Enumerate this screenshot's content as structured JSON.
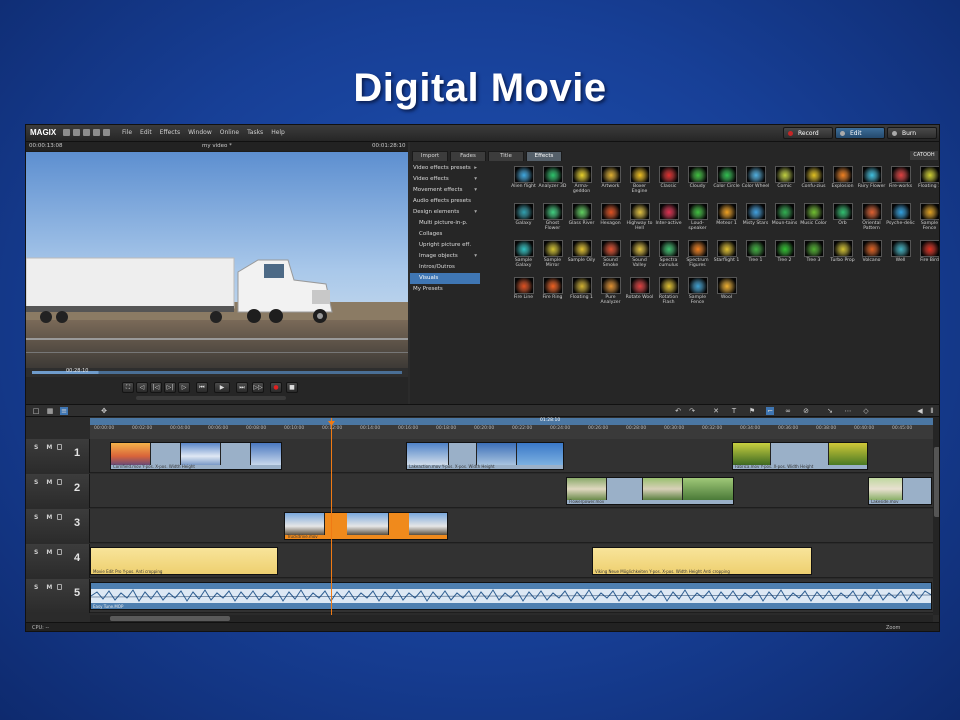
{
  "slide": {
    "title": "Digital Movie"
  },
  "app": {
    "logo": "MAGIX",
    "menu": [
      "File",
      "Edit",
      "Effects",
      "Window",
      "Online",
      "Tasks",
      "Help"
    ],
    "modes": [
      {
        "label": "Record",
        "active": false
      },
      {
        "label": "Edit",
        "active": true
      },
      {
        "label": "Burn",
        "active": false
      }
    ]
  },
  "preview": {
    "time_left": "00:00:13:08",
    "title": "my video *",
    "time_right": "00:01:28:10",
    "scrub_time": "00:28:10",
    "scrub_position": 0.18,
    "transport_buttons": [
      "⛶",
      "◁",
      "|◁",
      "▷|",
      "▷",
      "⏮",
      "▶",
      "⏭",
      "▷▷",
      "●",
      "■"
    ]
  },
  "panel": {
    "tabs": [
      {
        "label": "Import",
        "active": false
      },
      {
        "label": "Fades",
        "active": false
      },
      {
        "label": "Title",
        "active": false
      },
      {
        "label": "Effects",
        "active": true
      }
    ],
    "brand": "CATOOH",
    "categories": [
      {
        "label": "Video effects presets",
        "sub": false,
        "arrow": "▸",
        "selected": false
      },
      {
        "label": "Video effects",
        "sub": false,
        "arrow": "▾",
        "selected": false
      },
      {
        "label": "Movement effects",
        "sub": false,
        "arrow": "▾",
        "selected": false
      },
      {
        "label": "Audio effects presets",
        "sub": false,
        "arrow": "",
        "selected": false
      },
      {
        "label": "Design elements",
        "sub": false,
        "arrow": "▾",
        "selected": false
      },
      {
        "label": "Multi picture-in-p.",
        "sub": true,
        "arrow": "",
        "selected": false
      },
      {
        "label": "Collages",
        "sub": true,
        "arrow": "",
        "selected": false
      },
      {
        "label": "Upright picture eff.",
        "sub": true,
        "arrow": "",
        "selected": false
      },
      {
        "label": "Image objects",
        "sub": true,
        "arrow": "▾",
        "selected": false
      },
      {
        "label": "Intros/Outros",
        "sub": true,
        "arrow": "",
        "selected": false
      },
      {
        "label": "Visuals",
        "sub": true,
        "arrow": "",
        "selected": true
      },
      {
        "label": "My Presets",
        "sub": false,
        "arrow": "",
        "selected": false
      }
    ],
    "effects": [
      {
        "label": "Alien flight",
        "color": "#3fa8e0"
      },
      {
        "label": "Analyzer 3D",
        "color": "#2cc36b"
      },
      {
        "label": "Arma-geddon",
        "color": "#e8d12a"
      },
      {
        "label": "Artwork",
        "color": "#e0b030"
      },
      {
        "label": "Boxer Engine",
        "color": "#f0c020"
      },
      {
        "label": "Classic",
        "color": "#e03030"
      },
      {
        "label": "Cloudy",
        "color": "#40c040"
      },
      {
        "label": "Color Circle",
        "color": "#30c050"
      },
      {
        "label": "Color Wheel",
        "color": "#50b0e0"
      },
      {
        "label": "Comic",
        "color": "#c0d040"
      },
      {
        "label": "Confu-zius",
        "color": "#e0c020"
      },
      {
        "label": "Explosion",
        "color": "#f08020"
      },
      {
        "label": "Fairy Flower",
        "color": "#40c0e0"
      },
      {
        "label": "Fire-works",
        "color": "#e04040"
      },
      {
        "label": "Floating 1",
        "color": "#d0d030"
      },
      {
        "label": "Galaxy",
        "color": "#30a0b0"
      },
      {
        "label": "Ghost Flower",
        "color": "#40d080"
      },
      {
        "label": "Glass River",
        "color": "#60d060"
      },
      {
        "label": "Hexagon",
        "color": "#e05020"
      },
      {
        "label": "Highway to Hell",
        "color": "#e0c040"
      },
      {
        "label": "Inter-active",
        "color": "#e03050"
      },
      {
        "label": "Loud-speaker",
        "color": "#40c040"
      },
      {
        "label": "Meteor 1",
        "color": "#f0a020"
      },
      {
        "label": "Misty Stars",
        "color": "#40a0e0"
      },
      {
        "label": "Moun-tains",
        "color": "#30b050"
      },
      {
        "label": "Music Color",
        "color": "#70c030"
      },
      {
        "label": "Orb",
        "color": "#30c070"
      },
      {
        "label": "Oriental Pattern",
        "color": "#e06030"
      },
      {
        "label": "Psyche-delic",
        "color": "#30a0e0"
      },
      {
        "label": "Sample Fence",
        "color": "#e0a020"
      },
      {
        "label": "Sample Galaxy",
        "color": "#30c0c0"
      },
      {
        "label": "Sample Mirror",
        "color": "#d0c030"
      },
      {
        "label": "Sample Oily",
        "color": "#e0c030"
      },
      {
        "label": "Sound Smoke",
        "color": "#e05030"
      },
      {
        "label": "Sound Valley",
        "color": "#e0c040"
      },
      {
        "label": "Spectra cumulus",
        "color": "#40c070"
      },
      {
        "label": "Spectrum Figures",
        "color": "#f08020"
      },
      {
        "label": "Starflight 1",
        "color": "#e0c030"
      },
      {
        "label": "Tree 1",
        "color": "#40b040"
      },
      {
        "label": "Tree 2",
        "color": "#30c030"
      },
      {
        "label": "Tree 3",
        "color": "#50b030"
      },
      {
        "label": "Turbo Prop",
        "color": "#d0c030"
      },
      {
        "label": "Volcano",
        "color": "#e06020"
      },
      {
        "label": "Well",
        "color": "#40b0c0"
      },
      {
        "label": "Fire Bird",
        "color": "#e03020"
      },
      {
        "label": "Fire Line",
        "color": "#e05020"
      },
      {
        "label": "Fire Ring",
        "color": "#f06020"
      },
      {
        "label": "Floating 1",
        "color": "#d0b030"
      },
      {
        "label": "Pure Analyzer",
        "color": "#e09030"
      },
      {
        "label": "Rotate Wool",
        "color": "#e04040"
      },
      {
        "label": "Rotation Flash",
        "color": "#e0c030"
      },
      {
        "label": "Sample Fence",
        "color": "#40a0d0"
      },
      {
        "label": "Wool",
        "color": "#f0b030"
      }
    ]
  },
  "timeline": {
    "ruler_band_label": "01:28:10",
    "ticks": [
      "00:00:00",
      "00:02:00",
      "00:04:00",
      "00:06:00",
      "00:08:00",
      "00:10:00",
      "00:12:00",
      "00:14:00",
      "00:16:00",
      "00:18:00",
      "00:20:00",
      "00:22:00",
      "00:24:00",
      "00:26:00",
      "00:28:00",
      "00:30:00",
      "00:32:00",
      "00:34:00",
      "00:36:00",
      "00:38:00",
      "00:40:00",
      "00:45:00"
    ],
    "tracks": [
      {
        "number": "1",
        "sm": "S M",
        "clips": [
          {
            "caption": "Cornfield.mov   Y-pos.  X-pos.  Width  Height"
          },
          {
            "caption": "Lakeaction.mov   Y-pos.  X-pos.  Width  Height"
          },
          {
            "caption": "Fabrica.mov   Y-pos.  X-pos.  Width  Height"
          }
        ]
      },
      {
        "number": "2",
        "sm": "S M",
        "clips": [
          {
            "caption": "Flowerpower.mov"
          },
          {
            "caption": "Lakeside.mov"
          }
        ]
      },
      {
        "number": "3",
        "sm": "S M",
        "clips": [
          {
            "caption": "Truckdrive.mov"
          }
        ]
      },
      {
        "number": "4",
        "sm": "S M",
        "clips": [
          {
            "caption": "Movie Edit Pro   Y-pos.  Anti cropping"
          },
          {
            "caption": "Viking Neue Möglichkeiten   Y-pos.  X-pos.  Width  Height  Anti cropping"
          }
        ]
      },
      {
        "number": "5",
        "sm": "S M",
        "clips": [
          {
            "caption": "Easy Tune.MOP"
          }
        ]
      }
    ],
    "status_left": "CPU: --",
    "zoom_label": "Zoom"
  }
}
